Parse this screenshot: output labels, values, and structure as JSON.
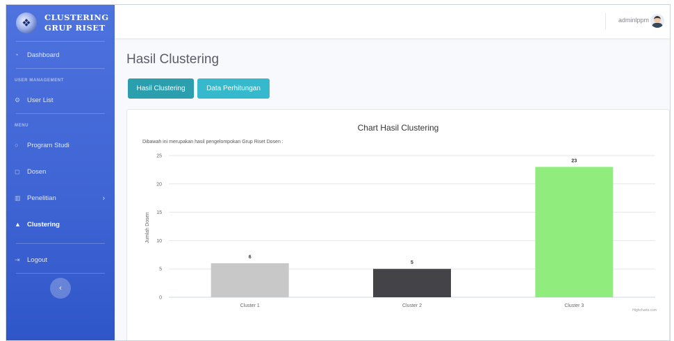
{
  "sidebar": {
    "brand": [
      "CLUSTERING",
      "GRUP RISET"
    ],
    "items": [
      {
        "label": "Dashboard",
        "icon": "dashboard-icon"
      },
      {
        "label": "User List",
        "icon": "gear-icon"
      },
      {
        "label": "Program Studi",
        "icon": "circle-icon"
      },
      {
        "label": "Dosen",
        "icon": "comment-icon"
      },
      {
        "label": "Penelitian",
        "icon": "bar-chart-icon"
      },
      {
        "label": "Clustering",
        "icon": "area-chart-icon"
      },
      {
        "label": "Logout",
        "icon": "logout-icon"
      }
    ],
    "headings": [
      "USER MANAGEMENT",
      "MENU"
    ],
    "toggle_glyph": "‹"
  },
  "topbar": {
    "username": "adminlppm"
  },
  "main": {
    "title": "Hasil Clustering",
    "buttons": [
      "Hasil Clustering",
      "Data Perhitungan"
    ]
  },
  "chart_data": {
    "type": "bar",
    "title": "Chart Hasil Clustering",
    "subtitle": "Dibawah ini merupakan hasil pengelompokan Grup Riset Dosen :",
    "ylabel": "Jumlah Dosen",
    "xlabel": "",
    "categories": [
      "Cluster 1",
      "Cluster 2",
      "Cluster 3"
    ],
    "values": [
      6,
      5,
      23
    ],
    "colors": [
      "#c8c8c8",
      "#434348",
      "#90ed7d"
    ],
    "ylim": [
      0,
      25
    ],
    "yticks": [
      0,
      5,
      10,
      15,
      20,
      25
    ],
    "grid": true,
    "credits": "Highcharts.com"
  }
}
